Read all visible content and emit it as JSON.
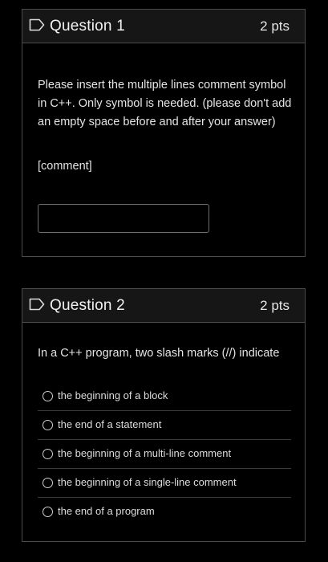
{
  "questions": [
    {
      "title": "Question 1",
      "points": "2 pts",
      "prompt": "Please insert the multiple lines comment symbol in C++. Only symbol is needed. (please don't add an empty space before and after your answer)",
      "tag": "[comment]",
      "answer_value": ""
    },
    {
      "title": "Question 2",
      "points": "2 pts",
      "prompt": "In a C++ program, two slash marks (//) indicate",
      "options": [
        "the beginning of a block",
        "the end of a statement",
        "the beginning of a multi-line comment",
        "the beginning of a single-line comment",
        "the end of a program"
      ]
    }
  ],
  "icons": {
    "question_flag": "flag-outline-icon"
  },
  "colors": {
    "background": "#000000",
    "header_background": "#161616",
    "border": "#4b4b4b",
    "text": "#e6e6e6"
  }
}
